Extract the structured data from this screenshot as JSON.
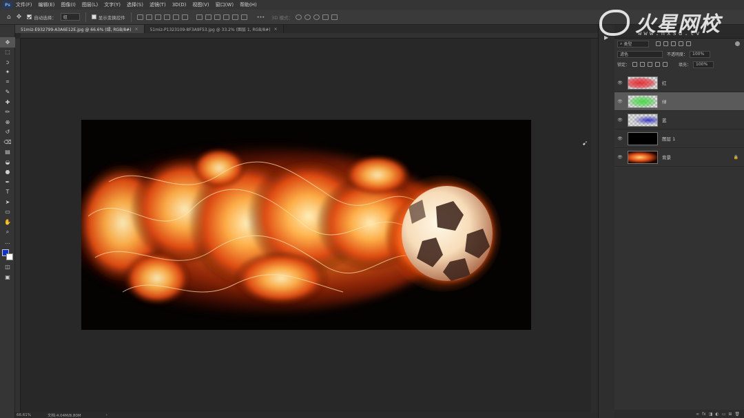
{
  "app": {
    "logo": "Ps"
  },
  "menu": [
    "文件(F)",
    "编辑(E)",
    "图像(I)",
    "图层(L)",
    "文字(Y)",
    "选择(S)",
    "滤镜(T)",
    "3D(D)",
    "视图(V)",
    "窗口(W)",
    "帮助(H)"
  ],
  "options": {
    "auto_select_label": "自动选择：",
    "auto_select_value": "组",
    "transform_label": "显示变换控件",
    "mode_3d_label": "3D 模式："
  },
  "tabs": [
    {
      "label": "51miz-E932799-A3A6E12E.jpg @ 66.6% (绿, RGB/8#)",
      "close": "×",
      "active": true
    },
    {
      "label": "51miz-P1323109-8F3A9F53.jpg @ 33.2% (图层 1, RGB/8#)",
      "close": "×",
      "active": false
    }
  ],
  "toolbar_icons": [
    "move-icon",
    "marquee-icon",
    "lasso-icon",
    "magic-wand-icon",
    "crop-icon",
    "eyedropper-icon",
    "healing-icon",
    "brush-icon",
    "stamp-icon",
    "history-brush-icon",
    "eraser-icon",
    "gradient-icon",
    "blur-icon",
    "dodge-icon",
    "pen-icon",
    "type-icon",
    "path-select-icon",
    "shape-icon",
    "hand-icon",
    "zoom-icon",
    "more-icon",
    "color-swatch-icon",
    "quickmask-icon",
    "screen-mode-icon"
  ],
  "toolbar_glyphs": [
    "✥",
    "⬚",
    "ↄ",
    "✦",
    "⌗",
    "✎",
    "✚",
    "✏",
    "⊕",
    "↺",
    "⌫",
    "▤",
    "◒",
    "●",
    "✒",
    "T",
    "➤",
    "▭",
    "✋",
    "⌕",
    "…",
    "■",
    "◫",
    "▣"
  ],
  "layers_panel": {
    "filter_kind": "类型",
    "blend_mode": "滤色",
    "opacity_label": "不透明度：",
    "opacity_value": "100%",
    "lock_label": "锁定：",
    "fill_label": "填充：",
    "fill_value": "100%",
    "layers": [
      {
        "name": "红",
        "visible": true,
        "selected": false,
        "thumb": "red"
      },
      {
        "name": "绿",
        "visible": true,
        "selected": true,
        "thumb": "green"
      },
      {
        "name": "蓝",
        "visible": true,
        "selected": false,
        "thumb": "blue"
      },
      {
        "name": "图层 1",
        "visible": true,
        "selected": false,
        "thumb": "black"
      },
      {
        "name": "背景",
        "visible": true,
        "selected": false,
        "thumb": "fire",
        "locked": true
      }
    ],
    "bottom_icons": [
      "∞",
      "fx",
      "◨",
      "◐",
      "▭",
      "⊞",
      "🗑"
    ]
  },
  "status": {
    "zoom": "66.61%",
    "doc": "文档:4.04M/8.80M"
  },
  "watermark": {
    "title": "火星网校",
    "url": "www.hxsd.tv"
  }
}
